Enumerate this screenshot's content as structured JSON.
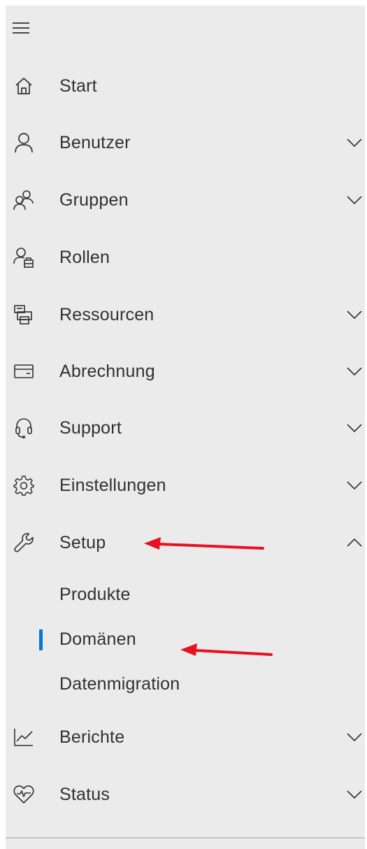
{
  "nav": {
    "menu_icon": "hamburger-menu-icon",
    "items": [
      {
        "id": "start",
        "label": "Start",
        "icon": "home-icon",
        "expandable": false
      },
      {
        "id": "benutzer",
        "label": "Benutzer",
        "icon": "person-icon",
        "expandable": true,
        "expanded": false
      },
      {
        "id": "gruppen",
        "label": "Gruppen",
        "icon": "people-group-icon",
        "expandable": true,
        "expanded": false
      },
      {
        "id": "rollen",
        "label": "Rollen",
        "icon": "person-role-icon",
        "expandable": false
      },
      {
        "id": "ressourcen",
        "label": "Ressourcen",
        "icon": "printer-resources-icon",
        "expandable": true,
        "expanded": false
      },
      {
        "id": "abrechnung",
        "label": "Abrechnung",
        "icon": "credit-card-icon",
        "expandable": true,
        "expanded": false
      },
      {
        "id": "support",
        "label": "Support",
        "icon": "headset-icon",
        "expandable": true,
        "expanded": false
      },
      {
        "id": "einstellungen",
        "label": "Einstellungen",
        "icon": "gear-icon",
        "expandable": true,
        "expanded": false
      },
      {
        "id": "setup",
        "label": "Setup",
        "icon": "wrench-icon",
        "expandable": true,
        "expanded": true
      },
      {
        "id": "berichte",
        "label": "Berichte",
        "icon": "line-chart-icon",
        "expandable": true,
        "expanded": false
      },
      {
        "id": "status",
        "label": "Status",
        "icon": "heart-pulse-icon",
        "expandable": true,
        "expanded": false
      }
    ],
    "setup_children": [
      {
        "label": "Produkte",
        "selected": false
      },
      {
        "label": "Domänen",
        "selected": true
      },
      {
        "label": "Datenmigration",
        "selected": false
      }
    ]
  },
  "colors": {
    "background": "#ebebeb",
    "text": "#323130",
    "icon": "#323130",
    "selected_indicator": "#0078d4",
    "annotation_arrow": "#e81123",
    "divider": "#c8c6c4"
  }
}
